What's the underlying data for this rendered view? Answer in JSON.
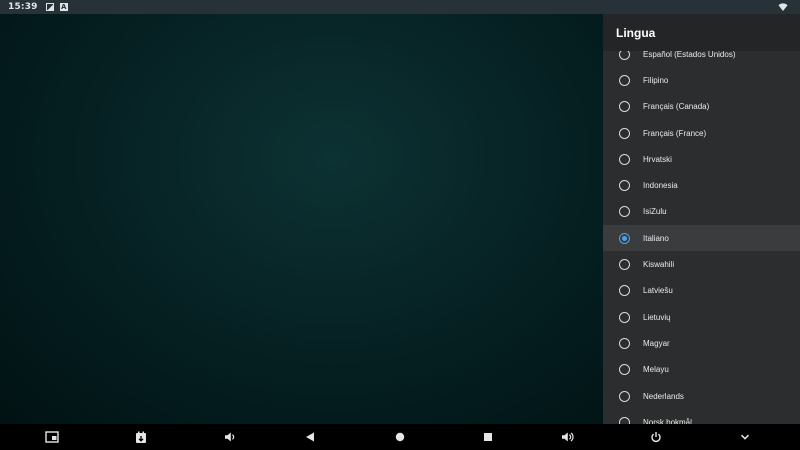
{
  "status_bar": {
    "time": "15:39",
    "notification_icons": [
      "image-icon",
      "text-a-icon"
    ],
    "right_icons": [
      "wifi-icon"
    ]
  },
  "panel": {
    "title": "Lingua",
    "selected": "Italiano",
    "items": [
      {
        "label": "Español (Estados Unidos)"
      },
      {
        "label": "Filipino"
      },
      {
        "label": "Français (Canada)"
      },
      {
        "label": "Français (France)"
      },
      {
        "label": "Hrvatski"
      },
      {
        "label": "Indonesia"
      },
      {
        "label": "IsiZulu"
      },
      {
        "label": "Italiano"
      },
      {
        "label": "Kiswahili"
      },
      {
        "label": "Latviešu"
      },
      {
        "label": "Lietuvių"
      },
      {
        "label": "Magyar"
      },
      {
        "label": "Melayu"
      },
      {
        "label": "Nederlands"
      },
      {
        "label": "Norsk bokmål"
      }
    ]
  },
  "nav_bar": {
    "buttons": [
      "picture-in-picture-icon",
      "screenshot-icon",
      "volume-down-icon",
      "back-icon",
      "home-icon",
      "recents-icon",
      "volume-up-icon",
      "power-icon",
      "chevron-down-icon"
    ]
  },
  "colors": {
    "accent": "#4aa3f0",
    "panel_bg": "#2b2d2e",
    "header_bg": "#232526",
    "status_bar_bg": "#263238"
  }
}
